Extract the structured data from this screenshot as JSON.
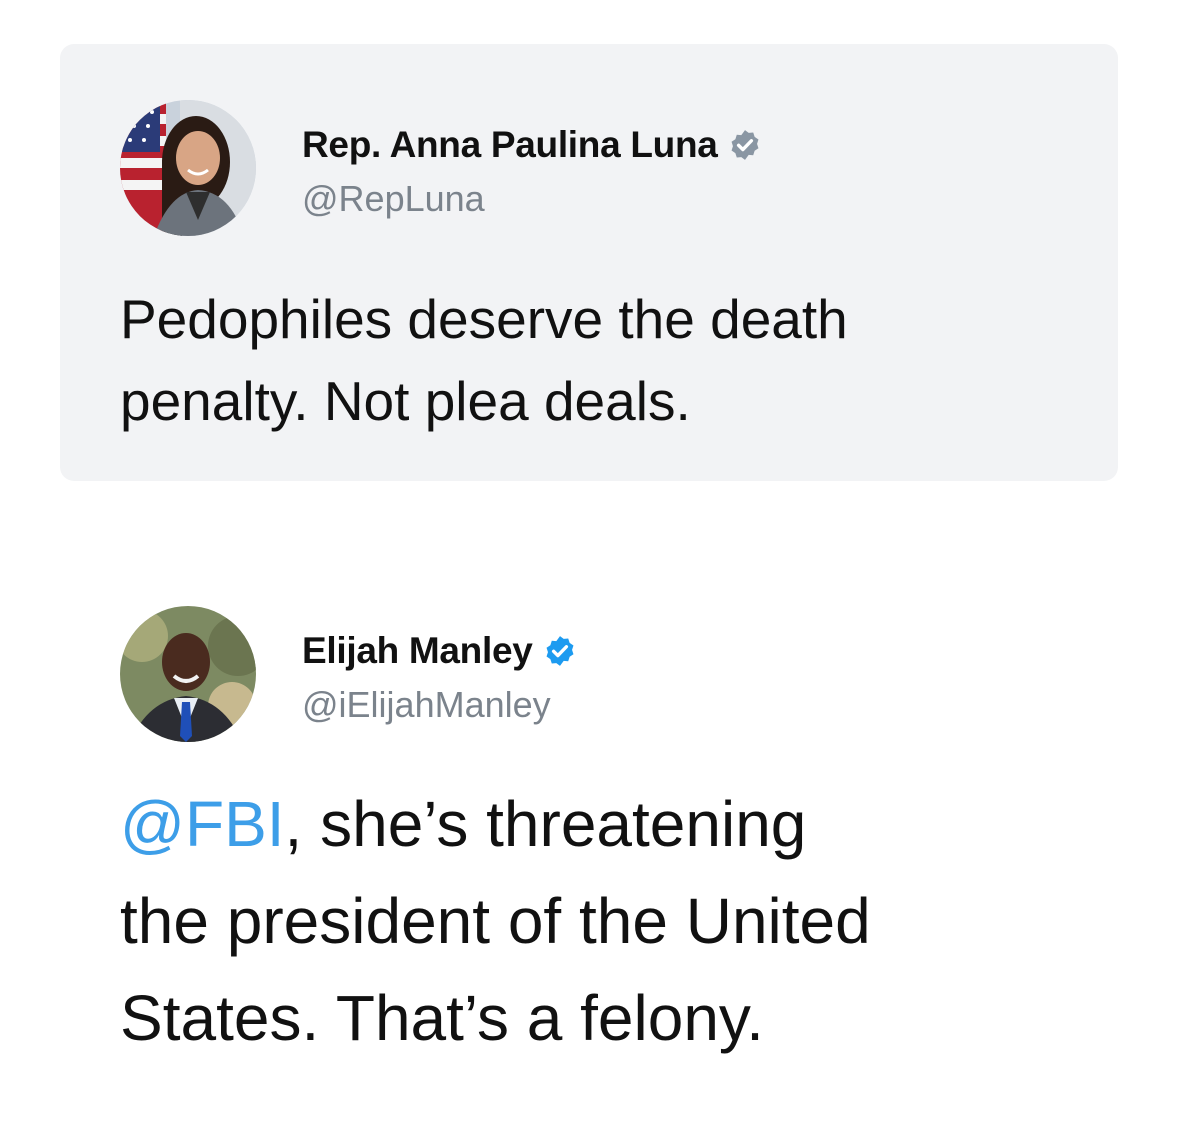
{
  "quoted_tweet": {
    "author": {
      "display_name": "Rep. Anna Paulina Luna",
      "handle": "@RepLuna",
      "verified_badge": "verified-badge-grey-icon",
      "badge_color": "#8a96a3"
    },
    "text_lines": [
      "Pedophiles deserve the death",
      "penalty. Not plea deals."
    ],
    "card_background": "#f2f3f5"
  },
  "reply_tweet": {
    "author": {
      "display_name": "Elijah Manley",
      "handle": "@iElijahManley",
      "verified_badge": "verified-badge-blue-icon",
      "badge_color": "#1d9bf0"
    },
    "mention": "@FBI",
    "text_lines": [
      ", she’s threatening",
      "the president of the United",
      "States. That’s a felony."
    ],
    "mention_color": "#3d9ee8"
  }
}
